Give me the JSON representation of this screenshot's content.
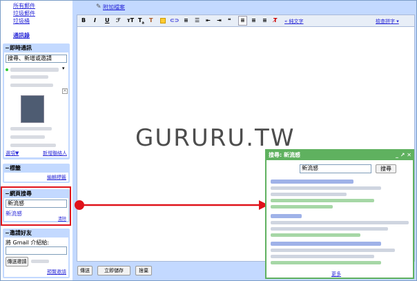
{
  "sidebar": {
    "links": [
      "所有郵件",
      "垃圾郵件",
      "垃圾桶"
    ],
    "contacts_link": "通訊錄",
    "chat": {
      "title": "即時通訊",
      "search_placeholder": "搜尋、新增或邀請",
      "options_link": "選項▼",
      "add_contact_link": "新增聯絡人"
    },
    "labels": {
      "title": "標籤",
      "edit_link": "編輯標籤"
    },
    "websearch": {
      "title": "網頁搜尋",
      "query": "新流感",
      "result_link": "新流感",
      "clear_link": "清除"
    },
    "invite": {
      "title": "邀請好友",
      "prompt": "將 Gmail 介紹給:",
      "send_button": "傳送邀請",
      "preview_link": "預覽邀請"
    }
  },
  "compose": {
    "attach_link": "附加檔案",
    "plain_text_link": "« 純文字",
    "spellcheck_link": "檢查拼字 ▾",
    "send_button": "傳送",
    "save_button": "立即儲存",
    "discard_button": "捨棄"
  },
  "watermark": "GURURU.TW",
  "gadget": {
    "title": "搜尋: 新流感",
    "query": "新流感",
    "search_button": "搜尋",
    "more_link": "更多"
  },
  "colors": {
    "highlight_red": "#e0121a",
    "gadget_green": "#5fb15f",
    "sidebar_blue": "#c3d9ff"
  }
}
